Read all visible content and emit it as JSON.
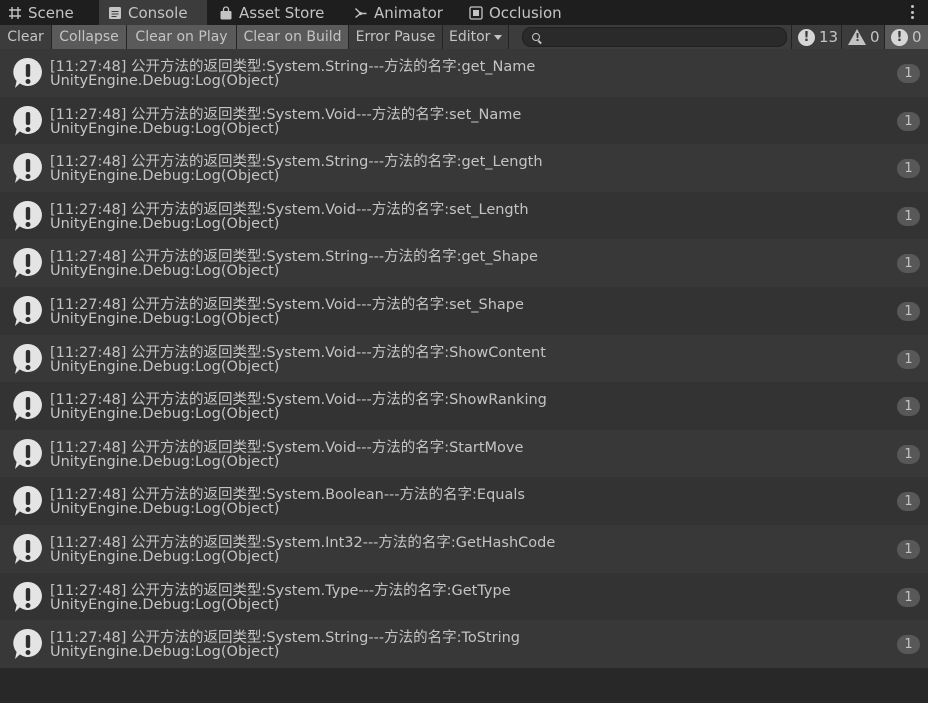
{
  "tabs": [
    {
      "label": "Scene",
      "icon": "grid-icon"
    },
    {
      "label": "Console",
      "icon": "console-icon",
      "active": true
    },
    {
      "label": "Asset Store",
      "icon": "store-bag-icon"
    },
    {
      "label": "Animator",
      "icon": "animator-icon"
    },
    {
      "label": "Occlusion",
      "icon": "occlusion-icon"
    }
  ],
  "toolbar": {
    "clear": "Clear",
    "collapse": "Collapse",
    "clear_on_play": "Clear on Play",
    "clear_on_build": "Clear on Build",
    "error_pause": "Error Pause",
    "editor": "Editor",
    "search_placeholder": "",
    "log_count": "13",
    "warning_count": "0",
    "error_count": "0"
  },
  "colors": {
    "background": "#282828",
    "row_odd": "#383838",
    "row_even": "#333333",
    "toolbar": "#3c3c3c",
    "toggle_on": "#5a5a5a",
    "text": "#c4c4c4"
  },
  "logs": [
    {
      "line1": "[11:27:48] 公开方法的返回类型:System.String---方法的名字:get_Name",
      "line2": "UnityEngine.Debug:Log(Object)",
      "count": "1"
    },
    {
      "line1": "[11:27:48] 公开方法的返回类型:System.Void---方法的名字:set_Name",
      "line2": "UnityEngine.Debug:Log(Object)",
      "count": "1"
    },
    {
      "line1": "[11:27:48] 公开方法的返回类型:System.String---方法的名字:get_Length",
      "line2": "UnityEngine.Debug:Log(Object)",
      "count": "1"
    },
    {
      "line1": "[11:27:48] 公开方法的返回类型:System.Void---方法的名字:set_Length",
      "line2": "UnityEngine.Debug:Log(Object)",
      "count": "1"
    },
    {
      "line1": "[11:27:48] 公开方法的返回类型:System.String---方法的名字:get_Shape",
      "line2": "UnityEngine.Debug:Log(Object)",
      "count": "1"
    },
    {
      "line1": "[11:27:48] 公开方法的返回类型:System.Void---方法的名字:set_Shape",
      "line2": "UnityEngine.Debug:Log(Object)",
      "count": "1"
    },
    {
      "line1": "[11:27:48] 公开方法的返回类型:System.Void---方法的名字:ShowContent",
      "line2": "UnityEngine.Debug:Log(Object)",
      "count": "1"
    },
    {
      "line1": "[11:27:48] 公开方法的返回类型:System.Void---方法的名字:ShowRanking",
      "line2": "UnityEngine.Debug:Log(Object)",
      "count": "1"
    },
    {
      "line1": "[11:27:48] 公开方法的返回类型:System.Void---方法的名字:StartMove",
      "line2": "UnityEngine.Debug:Log(Object)",
      "count": "1"
    },
    {
      "line1": "[11:27:48] 公开方法的返回类型:System.Boolean---方法的名字:Equals",
      "line2": "UnityEngine.Debug:Log(Object)",
      "count": "1"
    },
    {
      "line1": "[11:27:48] 公开方法的返回类型:System.Int32---方法的名字:GetHashCode",
      "line2": "UnityEngine.Debug:Log(Object)",
      "count": "1"
    },
    {
      "line1": "[11:27:48] 公开方法的返回类型:System.Type---方法的名字:GetType",
      "line2": "UnityEngine.Debug:Log(Object)",
      "count": "1"
    },
    {
      "line1": "[11:27:48] 公开方法的返回类型:System.String---方法的名字:ToString",
      "line2": "UnityEngine.Debug:Log(Object)",
      "count": "1"
    }
  ]
}
